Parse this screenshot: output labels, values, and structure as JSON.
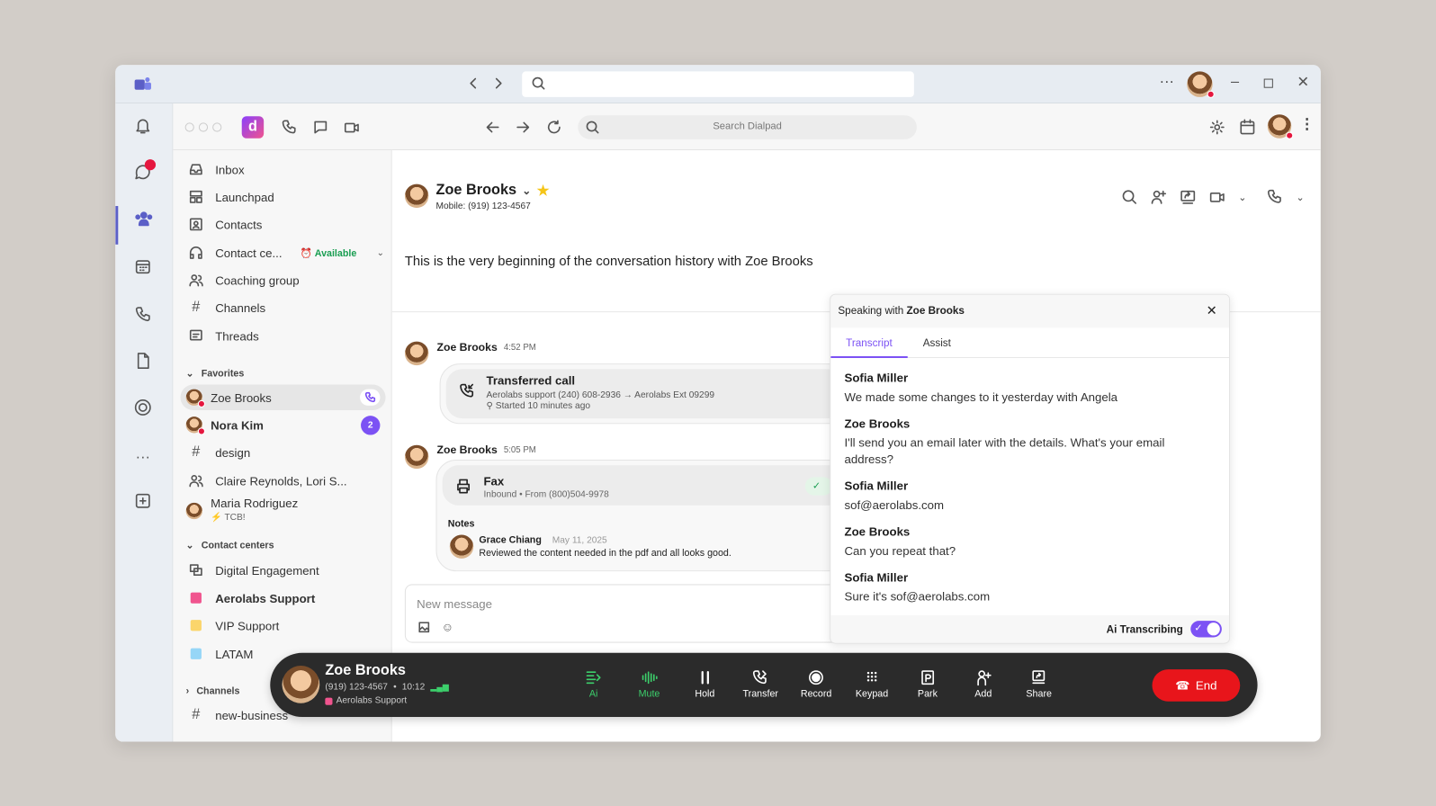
{
  "dialpad_search": {
    "placeholder": "Search Dialpad"
  },
  "sidebar": {
    "items": [
      {
        "label": "Inbox"
      },
      {
        "label": "Launchpad"
      },
      {
        "label": "Contacts"
      },
      {
        "label": "Contact ce..."
      },
      {
        "label": "Coaching group"
      },
      {
        "label": "Channels"
      },
      {
        "label": "Threads"
      }
    ],
    "status": "Available",
    "favorites": {
      "title": "Favorites",
      "items": [
        {
          "label": "Zoe Brooks"
        },
        {
          "label": "Nora Kim",
          "badge": "2"
        },
        {
          "label": "design"
        },
        {
          "label": "Claire Reynolds, Lori S..."
        },
        {
          "label": "Maria Rodriguez",
          "sub": "TCB!"
        }
      ]
    },
    "contact_centers": {
      "title": "Contact centers",
      "items": [
        {
          "label": "Digital Engagement"
        },
        {
          "label": "Aerolabs Support",
          "color": "#f0548e"
        },
        {
          "label": "VIP Support",
          "color": "#fbd56b"
        },
        {
          "label": "LATAM",
          "color": "#96d6f7"
        }
      ]
    },
    "channels": {
      "title": "Channels",
      "items": [
        {
          "label": "new-business"
        }
      ]
    }
  },
  "conversation": {
    "name": "Zoe Brooks",
    "mobile": "Mobile: (919) 123-4567",
    "beginning": "This is the very beginning of the conversation history with Zoe Brooks",
    "messages": [
      {
        "author": "Zoe Brooks",
        "time": "4:52 PM",
        "title": "Transferred call",
        "detail": "Aerolabs support (240) 608-2936 → Aerolabs Ext 09299",
        "sub": "Started 10 minutes ago"
      },
      {
        "author": "Zoe Brooks",
        "time": "5:05 PM",
        "title": "Fax",
        "detail": "Inbound • From (800)504-9978",
        "notes_label": "Notes",
        "note_author": "Grace Chiang",
        "note_date": "May 11, 2025",
        "note_text": "Reviewed the content needed in the pdf and all looks good."
      }
    ],
    "composer_placeholder": "New message"
  },
  "transcript_panel": {
    "prefix": "Speaking with ",
    "name": "Zoe Brooks",
    "tabs": [
      "Transcript",
      "Assist"
    ],
    "active_tab": "Transcript",
    "entries": [
      {
        "speaker": "Sofia Miller",
        "text": "We made some changes to it yesterday with Angela"
      },
      {
        "speaker": "Zoe Brooks",
        "text": "I'll send you an email later with the details. What's your email address?"
      },
      {
        "speaker": "Sofia Miller",
        "text": "sof@aerolabs.com"
      },
      {
        "speaker": "Zoe Brooks",
        "text": "Can you repeat that?"
      },
      {
        "speaker": "Sofia Miller",
        "text": "Sure it's sof@aerolabs.com"
      }
    ],
    "toggle_label": "Ai Transcribing",
    "toggle_on": true
  },
  "call_bar": {
    "name": "Zoe Brooks",
    "number": "(919) 123-4567",
    "duration": "10:12",
    "queue": "Aerolabs Support",
    "buttons": [
      {
        "label": "Ai",
        "icon": "ai-icon"
      },
      {
        "label": "Mute",
        "icon": "mute-icon"
      },
      {
        "label": "Hold",
        "icon": "pause-icon"
      },
      {
        "label": "Transfer",
        "icon": "transfer-icon"
      },
      {
        "label": "Record",
        "icon": "record-icon"
      },
      {
        "label": "Keypad",
        "icon": "keypad-icon"
      },
      {
        "label": "Park",
        "icon": "park-icon"
      },
      {
        "label": "Add",
        "icon": "add-person-icon"
      },
      {
        "label": "Share",
        "icon": "share-icon"
      }
    ],
    "end_label": "End"
  },
  "colors": {
    "accent": "#7c52f4",
    "green": "#3ccf6b",
    "end": "#e8151b",
    "notification": "#e5173f"
  }
}
